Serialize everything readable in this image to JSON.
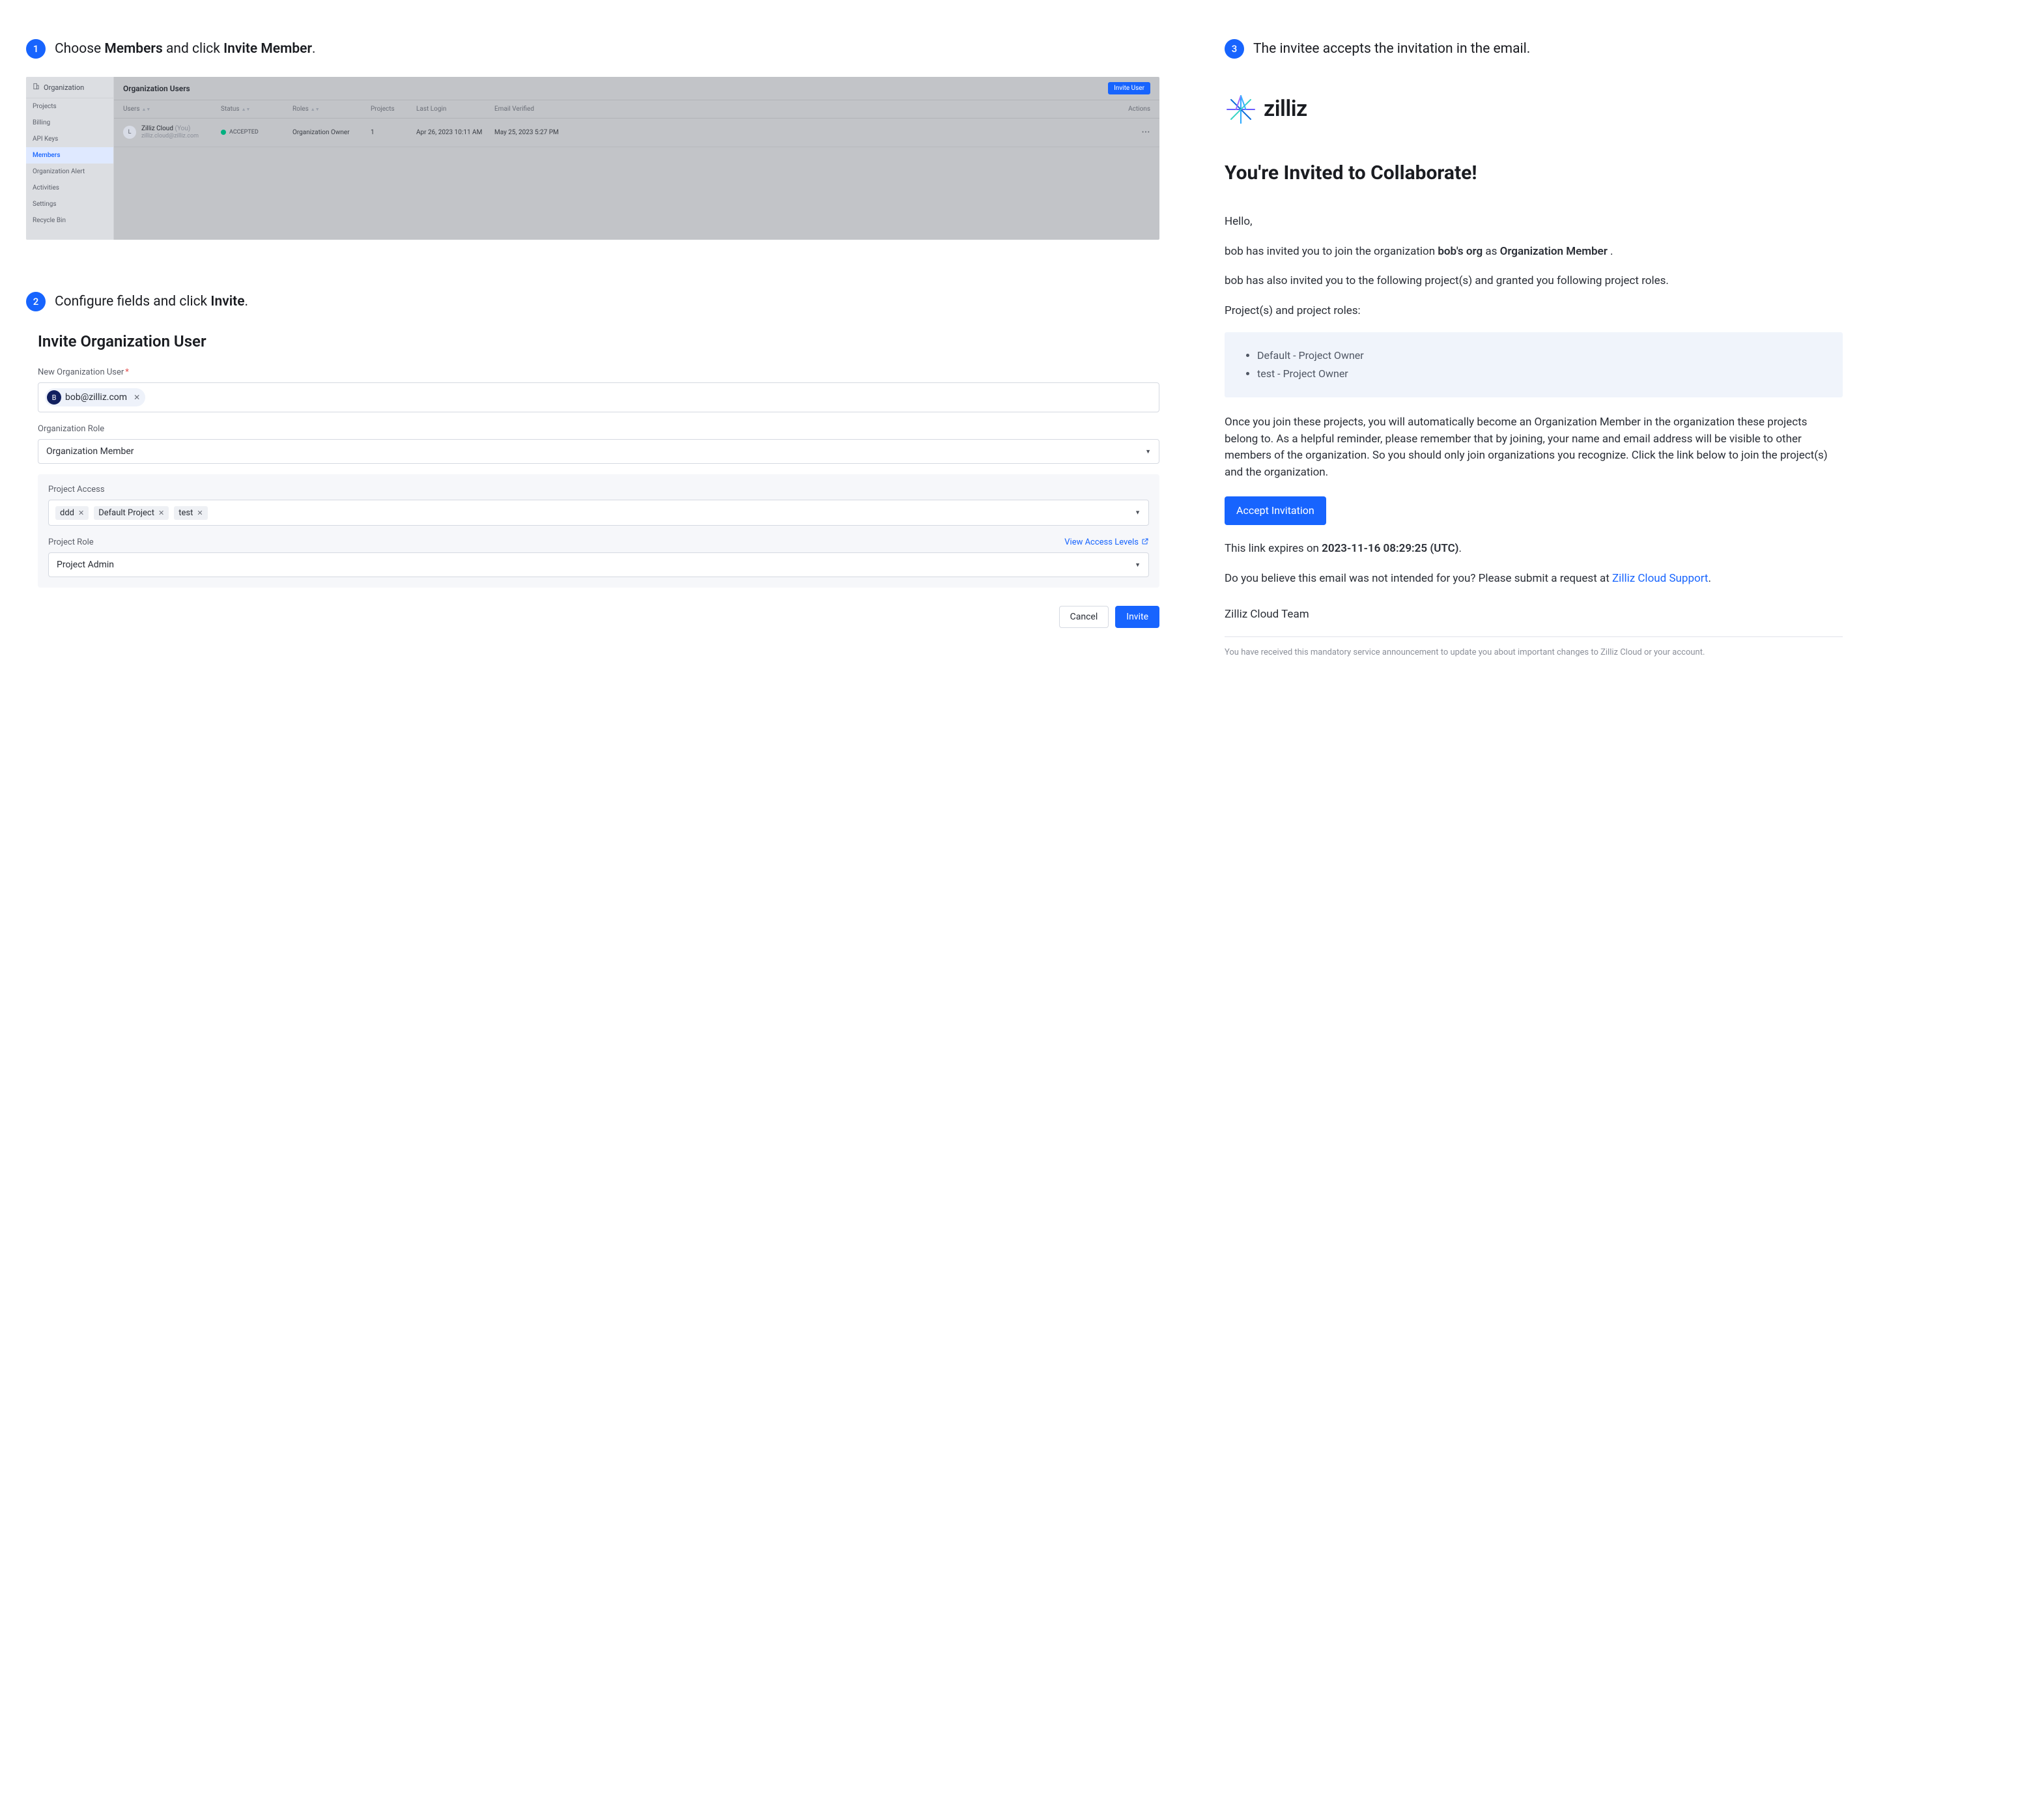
{
  "step1": {
    "text_parts": [
      "Choose ",
      "Members",
      " and click ",
      "Invite Member",
      "."
    ],
    "nav_org_label": "Organization",
    "nav_items": [
      "Projects",
      "Billing",
      "API Keys",
      "Members",
      "Organization Alert",
      "Activities",
      "Settings",
      "Recycle Bin"
    ],
    "nav_active_index": 3,
    "page_title": "Organization Users",
    "invite_button": "Invite User",
    "columns": {
      "users": "Users",
      "status": "Status",
      "roles": "Roles",
      "projects": "Projects",
      "last_login": "Last Login",
      "email_verified": "Email Verified",
      "actions": "Actions"
    },
    "row": {
      "avatar_letter": "L",
      "name": "Zilliz Cloud",
      "you_suffix": "(You)",
      "email": "zilliz.cloud@zilliz.com",
      "status": "ACCEPTED",
      "role": "Organization Owner",
      "projects": "1",
      "last_login": "Apr 26, 2023 10:11 AM",
      "email_verified": "May 25, 2023 5:27 PM"
    }
  },
  "step2": {
    "text_parts": [
      "Configure fields and click ",
      "Invite",
      "."
    ],
    "form_title": "Invite Organization User",
    "new_user_label": "New Organization User",
    "chip": {
      "avatar_letter": "B",
      "email": "bob@zilliz.com"
    },
    "org_role_label": "Organization Role",
    "org_role_value": "Organization Member",
    "project_access_label": "Project Access",
    "project_tags": [
      "ddd",
      "Default Project",
      "test"
    ],
    "project_role_label": "Project Role",
    "view_access_levels": "View Access Levels",
    "project_role_value": "Project Admin",
    "cancel": "Cancel",
    "invite": "Invite"
  },
  "step3": {
    "text": "The invitee accepts the invitation in the email.",
    "logo_text": "zilliz",
    "headline": "You're Invited to Collaborate!",
    "greeting": "Hello,",
    "line1_parts": [
      "bob has invited you to join the organization ",
      "bob's org",
      " as ",
      "Organization Member",
      " ."
    ],
    "line2": "bob has also invited you to the following project(s) and granted you following project roles.",
    "projects_label": "Project(s) and project roles:",
    "projects": [
      "Default - Project Owner",
      "test - Project Owner"
    ],
    "paragraph": "Once you join these projects, you will automatically become an Organization Member in the organization these projects belong to. As a helpful reminder, please remember that by joining, your name and email address will be visible to other members of the organization. So you should only join organizations you recognize. Click the link below to join the project(s) and the organization.",
    "accept_button": "Accept Invitation",
    "expires_parts": [
      "This link expires on ",
      "2023-11-16 08:29:25 (UTC)",
      "."
    ],
    "wrong_email_parts": [
      "Do you believe this email was not intended for you? Please submit a request at ",
      "Zilliz Cloud Support",
      "."
    ],
    "signoff": "Zilliz Cloud Team",
    "footer": "You have received this mandatory service announcement to update you about important changes to Zilliz Cloud or your account."
  }
}
